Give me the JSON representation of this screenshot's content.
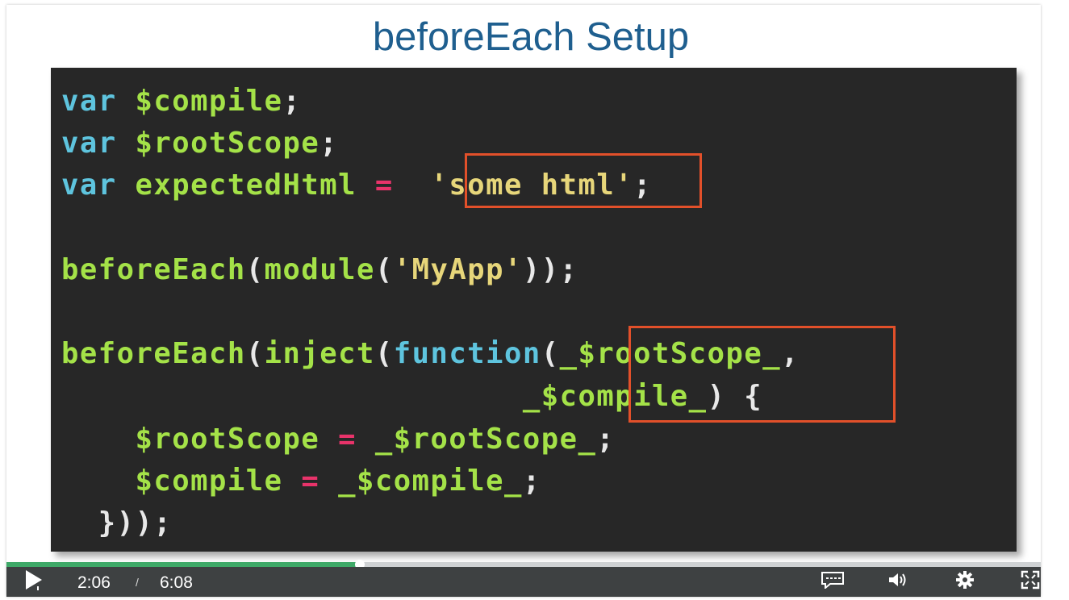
{
  "slide": {
    "title": "beforeEach Setup"
  },
  "code": {
    "lines": [
      [
        [
          "kw",
          "var"
        ],
        [
          "pn",
          " "
        ],
        [
          "id",
          "$compile"
        ],
        [
          "pn",
          ";"
        ]
      ],
      [
        [
          "kw",
          "var"
        ],
        [
          "pn",
          " "
        ],
        [
          "id",
          "$rootScope"
        ],
        [
          "pn",
          ";"
        ]
      ],
      [
        [
          "kw",
          "var"
        ],
        [
          "pn",
          " "
        ],
        [
          "id",
          "expectedHtml"
        ],
        [
          "pn",
          " "
        ],
        [
          "op",
          "="
        ],
        [
          "pn",
          "  "
        ],
        [
          "str",
          "'some html'"
        ],
        [
          "pn",
          ";"
        ]
      ],
      [],
      [
        [
          "id",
          "beforeEach"
        ],
        [
          "pn",
          "("
        ],
        [
          "id",
          "module"
        ],
        [
          "pn",
          "("
        ],
        [
          "str",
          "'MyApp'"
        ],
        [
          "pn",
          "));"
        ]
      ],
      [],
      [
        [
          "id",
          "beforeEach"
        ],
        [
          "pn",
          "("
        ],
        [
          "id",
          "inject"
        ],
        [
          "pn",
          "("
        ],
        [
          "kw",
          "function"
        ],
        [
          "pn",
          "("
        ],
        [
          "id",
          "_$rootScope_"
        ],
        [
          "pn",
          ","
        ]
      ],
      [
        [
          "pn",
          "                         "
        ],
        [
          "id",
          "_$compile_"
        ],
        [
          "pn",
          ") {"
        ]
      ],
      [
        [
          "pn",
          "    "
        ],
        [
          "id",
          "$rootScope"
        ],
        [
          "pn",
          " "
        ],
        [
          "op",
          "="
        ],
        [
          "pn",
          " "
        ],
        [
          "id",
          "_$rootScope_"
        ],
        [
          "pn",
          ";"
        ]
      ],
      [
        [
          "pn",
          "    "
        ],
        [
          "id",
          "$compile"
        ],
        [
          "pn",
          " "
        ],
        [
          "op",
          "="
        ],
        [
          "pn",
          " "
        ],
        [
          "id",
          "_$compile_"
        ],
        [
          "pn",
          ";"
        ]
      ],
      [
        [
          "pn",
          "  }));"
        ]
      ]
    ]
  },
  "colors": {
    "keyword": "#5ec4de",
    "identifier": "#a4e248",
    "operator": "#e8336a",
    "string": "#e7d67a",
    "highlight_box": "#e2502a",
    "progress_played": "#3fa968",
    "title": "#1f5f8f"
  },
  "player": {
    "current_time": "2:06",
    "separator": "/",
    "duration": "6:08",
    "progress_fraction": 0.342,
    "icons": {
      "play": "play-icon",
      "captions": "captions-icon",
      "volume": "volume-icon",
      "settings": "gear-icon",
      "fullscreen": "fullscreen-icon"
    }
  }
}
